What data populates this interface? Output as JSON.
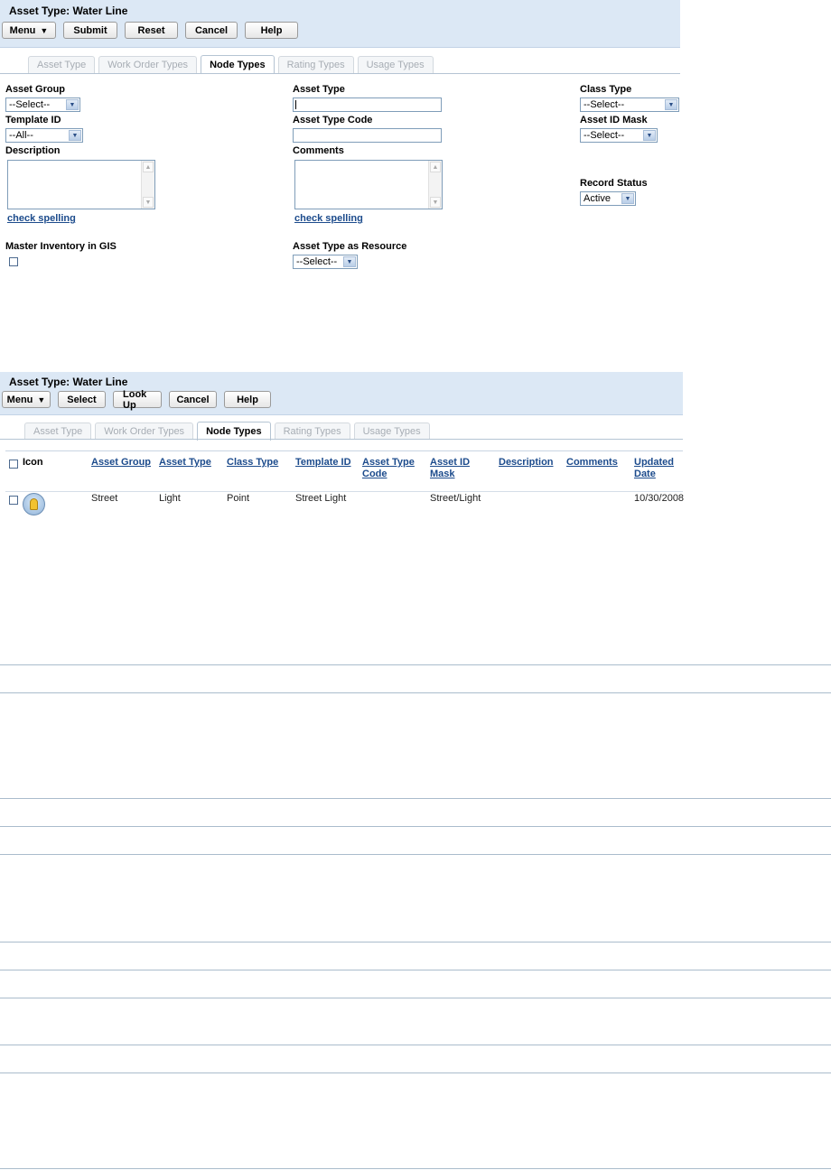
{
  "form": {
    "title": "Asset Type: Water Line",
    "buttons": {
      "menu": "Menu",
      "submit": "Submit",
      "reset": "Reset",
      "cancel": "Cancel",
      "help": "Help"
    },
    "tabs": [
      "Asset Type",
      "Work Order Types",
      "Node Types",
      "Rating Types",
      "Usage Types"
    ],
    "active_tab": "Node Types",
    "fields": {
      "asset_group": {
        "label": "Asset Group",
        "value": "--Select--"
      },
      "template_id": {
        "label": "Template ID",
        "value": "--All--"
      },
      "description": {
        "label": "Description"
      },
      "asset_type": {
        "label": "Asset Type",
        "value": ""
      },
      "asset_type_code": {
        "label": "Asset Type Code",
        "value": ""
      },
      "comments": {
        "label": "Comments"
      },
      "class_type": {
        "label": "Class Type",
        "value": "--Select--"
      },
      "asset_id_mask": {
        "label": "Asset ID Mask",
        "value": "--Select--"
      },
      "record_status": {
        "label": "Record Status",
        "value": "Active"
      },
      "master_inventory": {
        "label": "Master Inventory in GIS",
        "checked": false
      },
      "asset_type_resource": {
        "label": "Asset Type as Resource",
        "value": "--Select--"
      }
    },
    "check_spelling": "check spelling"
  },
  "results": {
    "title": "Asset Type: Water Line",
    "buttons": {
      "menu": "Menu",
      "select": "Select",
      "lookup": "Look Up",
      "cancel": "Cancel",
      "help": "Help"
    },
    "tabs": [
      "Asset Type",
      "Work Order Types",
      "Node Types",
      "Rating Types",
      "Usage Types"
    ],
    "active_tab": "Node Types",
    "columns": {
      "icon": "Icon",
      "asset_group": "Asset Group",
      "asset_type": "Asset Type",
      "class_type": "Class Type",
      "template_id": "Template ID",
      "asset_type_code_1": "Asset Type",
      "asset_type_code_2": "Code",
      "asset_id_mask_1": "Asset ID",
      "asset_id_mask_2": "Mask",
      "description": "Description",
      "comments": "Comments",
      "updated_date_1": "Updated",
      "updated_date_2": "Date"
    },
    "rows": [
      {
        "icon": "light-bulb-icon",
        "asset_group": "Street",
        "asset_type": "Light",
        "class_type": "Point",
        "template_id": "Street Light",
        "asset_type_code": "",
        "asset_id_mask": "Street/Light",
        "description": "",
        "comments": "",
        "updated_date": "10/30/2008"
      }
    ]
  },
  "colors": {
    "header_bg": "#dce8f5",
    "link": "#1c4b8c",
    "rule": "#aabccc"
  }
}
